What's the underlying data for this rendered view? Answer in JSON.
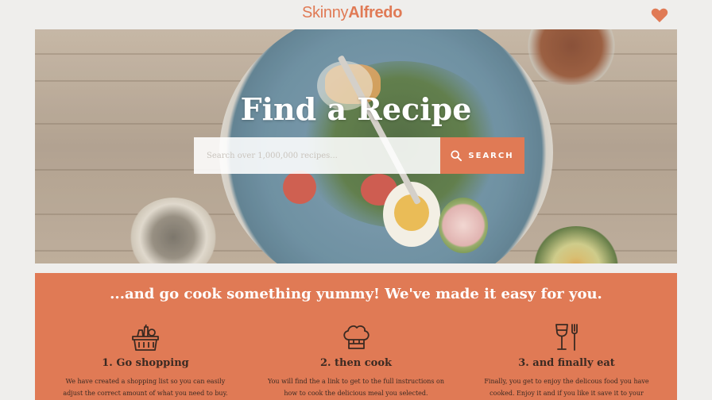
{
  "header": {
    "logo_light": "Skinny",
    "logo_bold": "Alfredo",
    "favorites_icon": "heart-icon",
    "accent_color": "#e07a55"
  },
  "hero": {
    "title": "Find a Recipe",
    "search": {
      "placeholder": "Search over 1,000,000 recipes...",
      "value": "",
      "button_label": "SEARCH",
      "button_icon": "search-icon"
    }
  },
  "how_it_works": {
    "heading": "...and go cook something yummy! We've made it easy for you.",
    "steps": [
      {
        "icon": "shopping-basket-icon",
        "title": "1. Go shopping",
        "text": "We have created a shopping list so you can easily adjust the correct amount of what you need to buy."
      },
      {
        "icon": "chef-hat-icon",
        "title": "2. then cook",
        "text": "You will find the a link to get to the full instructions on how to cook the delicious meal you selected."
      },
      {
        "icon": "wine-glass-fork-icon",
        "title": "3. and finally eat",
        "text": "Finally, you get to enjoy the delicous food you have cooked. Enjoy it and if you like it save it to your favorites."
      }
    ]
  }
}
